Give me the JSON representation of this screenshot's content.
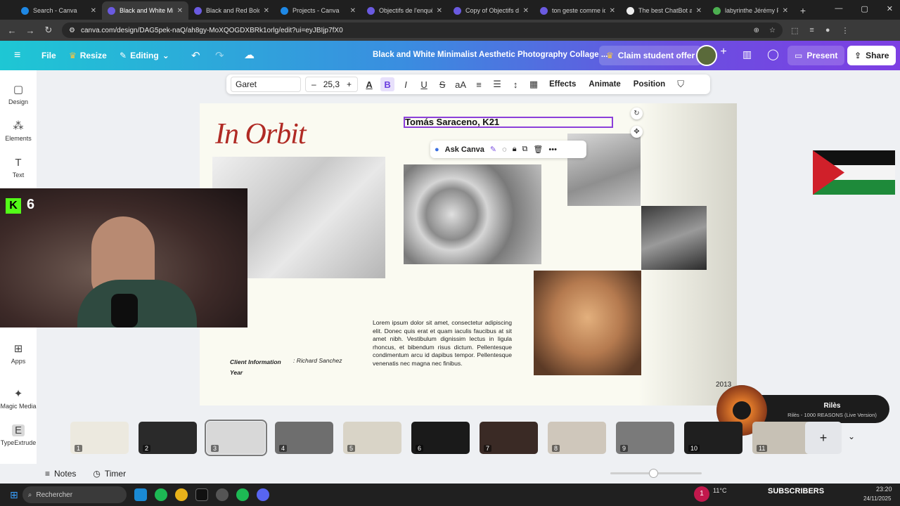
{
  "browser": {
    "tabs": [
      {
        "title": "Search - Canva",
        "active": false,
        "color": "#1e88e5"
      },
      {
        "title": "Black and White Mini",
        "active": true,
        "color": "#6a5ae0"
      },
      {
        "title": "Black and Red Bold M",
        "active": false,
        "color": "#6a5ae0"
      },
      {
        "title": "Projects - Canva",
        "active": false,
        "color": "#1e88e5"
      },
      {
        "title": "Objectifs de l'enquête",
        "active": false,
        "color": "#6a5ae0"
      },
      {
        "title": "Copy of Objectifs de",
        "active": false,
        "color": "#6a5ae0"
      },
      {
        "title": "ton geste comme ide",
        "active": false,
        "color": "#6a5ae0"
      },
      {
        "title": "The best ChatBot an",
        "active": false,
        "color": "#eeeeee"
      },
      {
        "title": "labyrinthe Jérémy Pr",
        "active": false,
        "color": "#4caf50"
      }
    ],
    "url": "canva.com/design/DAG5pek-naQ/ah8gy-MoXQOGDXBRk1orlg/edit?ui=eyJBIjp7fX0"
  },
  "canva": {
    "menu": {
      "file": "File",
      "resize": "Resize",
      "editing": "Editing"
    },
    "doc_title": "Black and White Minimalist Aesthetic Photography Collage ...",
    "claim": "Claim student offer",
    "present": "Present",
    "share": "Share"
  },
  "sidebar": {
    "items": [
      {
        "label": "Design",
        "icon": "design-icon"
      },
      {
        "label": "Elements",
        "icon": "elements-icon"
      },
      {
        "label": "Text",
        "icon": "text-icon"
      },
      {
        "label": "Apps",
        "icon": "apps-icon"
      },
      {
        "label": "Magic Media",
        "icon": "magic-media-icon"
      },
      {
        "label": "TypeExtrude",
        "icon": "typeextrude-icon"
      }
    ]
  },
  "toolbar": {
    "font": "Garet",
    "size": "25,3",
    "effects": "Effects",
    "animate": "Animate",
    "position": "Position"
  },
  "page": {
    "title": "In Orbit",
    "selected_text": "Tomás Saraceno, K21",
    "ask_canva": "Ask Canva",
    "lorem": "Lorem ipsum dolor sit amet, consectetur adipiscing elit. Donec quis erat et quam iaculis faucibus at sit amet nibh. Vestibulum dignissim lectus in ligula rhoncus, et bibendum risus dictum. Pellentesque condimentum arcu id dapibus tempor. Pellentesque venenatis nec magna nec finibus.",
    "client_label": "Client Information",
    "year_label": "Year",
    "client_value": ": Richard Sanchez",
    "year_value": "2013",
    "accent": "#b02a24"
  },
  "thumbnails": [
    "1",
    "2",
    "3",
    "4",
    "5",
    "6",
    "7",
    "8",
    "9",
    "10",
    "11"
  ],
  "bottom": {
    "notes": "Notes",
    "timer": "Timer"
  },
  "overlay": {
    "webcam_badge": "6",
    "music_title": "Rilès",
    "music_sub": "Rilès - 1000 REASONS (Live Version)",
    "subscribers": "SUBSCRIBERS"
  },
  "taskbar": {
    "search": "Rechercher",
    "weather": "11°C",
    "time": "23:20",
    "date": "24/11/2025",
    "badge": "1"
  }
}
